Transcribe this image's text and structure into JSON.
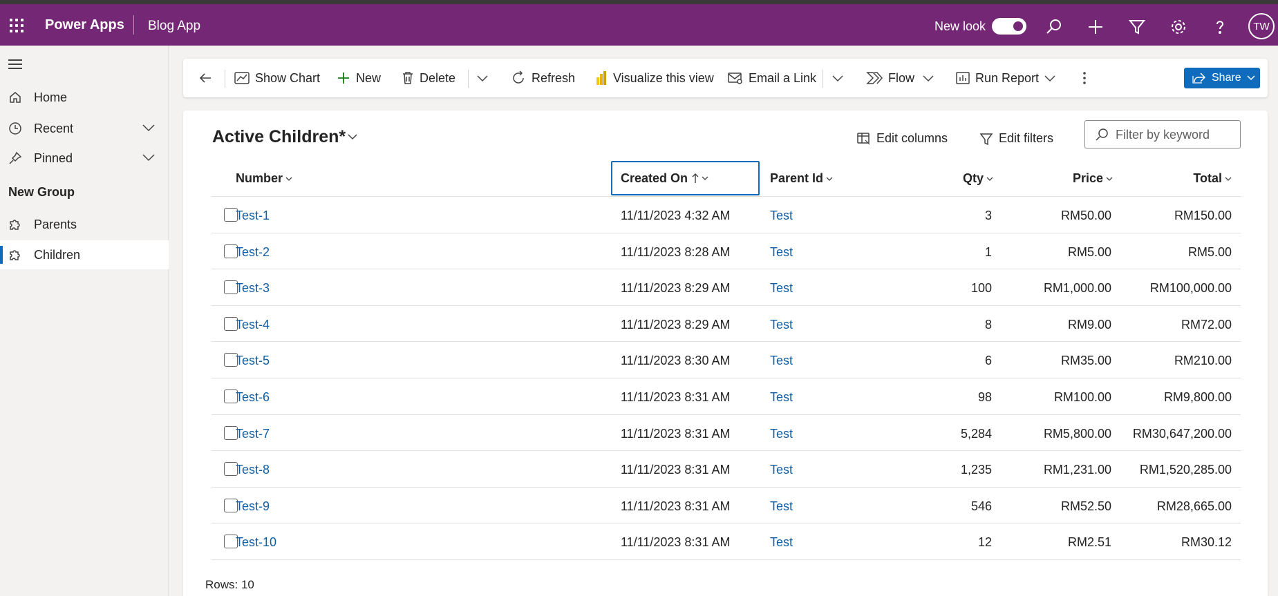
{
  "header": {
    "brand": "Power Apps",
    "app_name": "Blog App",
    "new_look_label": "New look",
    "new_look_on": true,
    "avatar_initials": "TW",
    "icons": [
      "app-launcher-icon",
      "search-icon",
      "add-icon",
      "filter-icon",
      "settings-icon",
      "help-icon"
    ]
  },
  "sidebar": {
    "items": [
      {
        "label": "Home",
        "icon": "home-icon"
      },
      {
        "label": "Recent",
        "icon": "clock-icon",
        "expandable": true
      },
      {
        "label": "Pinned",
        "icon": "pin-icon",
        "expandable": true
      }
    ],
    "group_name": "New Group",
    "group_items": [
      {
        "label": "Parents",
        "icon": "puzzle-icon",
        "active": false
      },
      {
        "label": "Children",
        "icon": "puzzle-icon",
        "active": true
      }
    ]
  },
  "commandbar": {
    "back_icon": "back-arrow-icon",
    "show_chart": "Show Chart",
    "new": "New",
    "delete": "Delete",
    "refresh": "Refresh",
    "visualize": "Visualize this view",
    "email_link": "Email a Link",
    "flow": "Flow",
    "run_report": "Run Report",
    "share": "Share"
  },
  "view": {
    "title": "Active Children*",
    "edit_columns": "Edit columns",
    "edit_filters": "Edit filters",
    "filter_placeholder": "Filter by keyword",
    "filter_value": ""
  },
  "grid": {
    "columns": [
      {
        "key": "number",
        "label": "Number"
      },
      {
        "key": "created_on",
        "label": "Created On",
        "sort": "ascending"
      },
      {
        "key": "parent_id",
        "label": "Parent Id"
      },
      {
        "key": "qty",
        "label": "Qty"
      },
      {
        "key": "price",
        "label": "Price"
      },
      {
        "key": "total",
        "label": "Total"
      }
    ],
    "rows": [
      {
        "number": "Test-1",
        "created_on": "11/11/2023 4:32 AM",
        "parent_id": "Test",
        "qty": "3",
        "price": "RM50.00",
        "total": "RM150.00"
      },
      {
        "number": "Test-2",
        "created_on": "11/11/2023 8:28 AM",
        "parent_id": "Test",
        "qty": "1",
        "price": "RM5.00",
        "total": "RM5.00"
      },
      {
        "number": "Test-3",
        "created_on": "11/11/2023 8:29 AM",
        "parent_id": "Test",
        "qty": "100",
        "price": "RM1,000.00",
        "total": "RM100,000.00"
      },
      {
        "number": "Test-4",
        "created_on": "11/11/2023 8:29 AM",
        "parent_id": "Test",
        "qty": "8",
        "price": "RM9.00",
        "total": "RM72.00"
      },
      {
        "number": "Test-5",
        "created_on": "11/11/2023 8:30 AM",
        "parent_id": "Test",
        "qty": "6",
        "price": "RM35.00",
        "total": "RM210.00"
      },
      {
        "number": "Test-6",
        "created_on": "11/11/2023 8:31 AM",
        "parent_id": "Test",
        "qty": "98",
        "price": "RM100.00",
        "total": "RM9,800.00"
      },
      {
        "number": "Test-7",
        "created_on": "11/11/2023 8:31 AM",
        "parent_id": "Test",
        "qty": "5,284",
        "price": "RM5,800.00",
        "total": "RM30,647,200.00"
      },
      {
        "number": "Test-8",
        "created_on": "11/11/2023 8:31 AM",
        "parent_id": "Test",
        "qty": "1,235",
        "price": "RM1,231.00",
        "total": "RM1,520,285.00"
      },
      {
        "number": "Test-9",
        "created_on": "11/11/2023 8:31 AM",
        "parent_id": "Test",
        "qty": "546",
        "price": "RM52.50",
        "total": "RM28,665.00"
      },
      {
        "number": "Test-10",
        "created_on": "11/11/2023 8:31 AM",
        "parent_id": "Test",
        "qty": "12",
        "price": "RM2.51",
        "total": "RM30.12"
      }
    ],
    "footer": "Rows: 10"
  },
  "colors": {
    "header_bg": "#742774",
    "accent": "#0f6cbd",
    "link": "#115ea3"
  }
}
